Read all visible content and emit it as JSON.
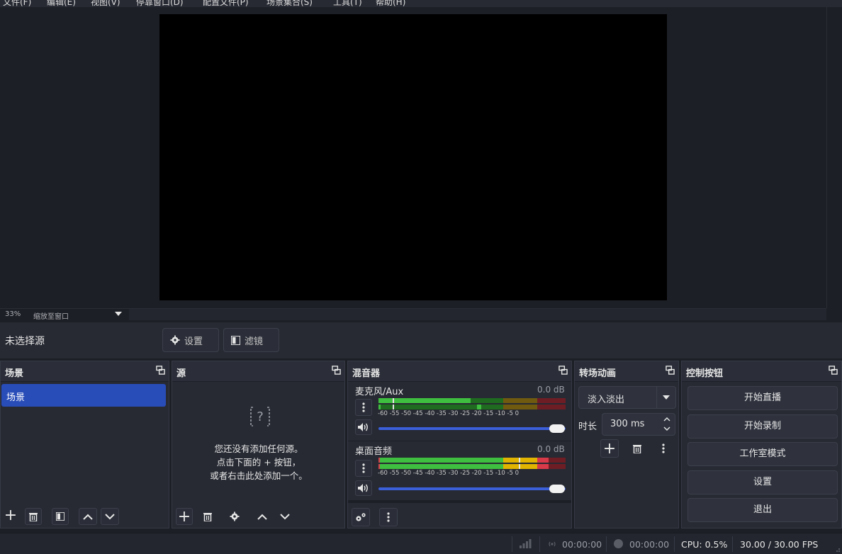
{
  "menu": [
    "文件(F)",
    "编辑(E)",
    "视图(V)",
    "停靠窗口(D)",
    "配置文件(P)",
    "场景集合(S)",
    "工具(T)",
    "帮助(H)"
  ],
  "zoom": {
    "percent": "33%",
    "mode": "缩放至窗口"
  },
  "source_bar": {
    "no_selection": "未选择源",
    "settings_label": "设置",
    "filters_label": "滤镜"
  },
  "scenes": {
    "title": "场景",
    "items": [
      "场景"
    ]
  },
  "sources": {
    "title": "源",
    "empty_line1": "您还没有添加任何源。",
    "empty_line2": "点击下面的 + 按钮，",
    "empty_line3": "或者右击此处添加一个。"
  },
  "mixer": {
    "title": "混音器",
    "channels": [
      {
        "name": "麦克风/Aux",
        "db": "0.0 dB",
        "volume": 1.0
      },
      {
        "name": "桌面音频",
        "db": "0.0 dB",
        "volume": 1.0
      }
    ],
    "scale": "-60 -55 -50 -45 -40 -35 -30 -25 -20 -15 -10 -5 0"
  },
  "transitions": {
    "title": "转场动画",
    "selected": "淡入淡出",
    "duration_label": "时长",
    "duration_value": "300 ms"
  },
  "controls": {
    "title": "控制按钮",
    "buttons": [
      "开始直播",
      "开始录制",
      "工作室模式",
      "设置",
      "退出"
    ]
  },
  "status": {
    "stream_time": "00:00:00",
    "record_time": "00:00:00",
    "cpu": "CPU: 0.5%",
    "fps": "30.00 / 30.00 FPS"
  },
  "colors": {
    "accent": "#284cb8",
    "meter_green": "#3fbf3f",
    "meter_yellow": "#e0b400",
    "meter_red": "#d93a4a",
    "slider_blue": "#3a5fd8"
  }
}
